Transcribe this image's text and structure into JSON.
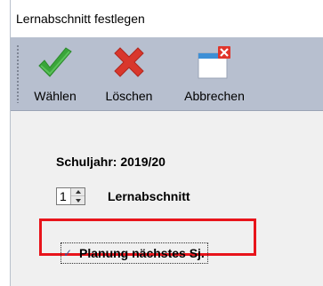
{
  "window": {
    "title": "Lernabschnitt festlegen"
  },
  "toolbar": {
    "select_label": "Wählen",
    "delete_label": "Löschen",
    "cancel_label": "Abbrechen"
  },
  "form": {
    "school_year": "Schuljahr: 2019/20",
    "section_value": "1",
    "section_label": "Lernabschnitt",
    "planning_checked": true,
    "planning_label": "Planung nächstes Sj."
  },
  "icons": {
    "select": "checkmark-icon",
    "delete": "red-x-icon",
    "cancel": "window-close-icon"
  },
  "colors": {
    "toolbar_bg": "#b7bfcf",
    "check_green": "#3aa53a",
    "delete_red": "#d9372c",
    "highlight_red": "#e8141b"
  }
}
